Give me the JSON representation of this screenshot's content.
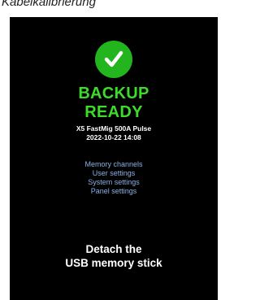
{
  "caption": "Kabelkalibrierung",
  "screen": {
    "icon": "check-icon",
    "status": {
      "line1": "BACKUP",
      "line2": "READY",
      "color": "#3ddc2b"
    },
    "device": {
      "model": "X5 FastMig 500A Pulse",
      "timestamp": "2022-10-22 14:08"
    },
    "items": [
      "Memory channels",
      "User settings",
      "System settings",
      "Panel settings"
    ],
    "instruction": {
      "line1": "Detach the",
      "line2": "USB memory stick"
    },
    "colors": {
      "background": "#000000",
      "check_circle": "#22b51e",
      "items_text": "#8ab1e6"
    }
  }
}
